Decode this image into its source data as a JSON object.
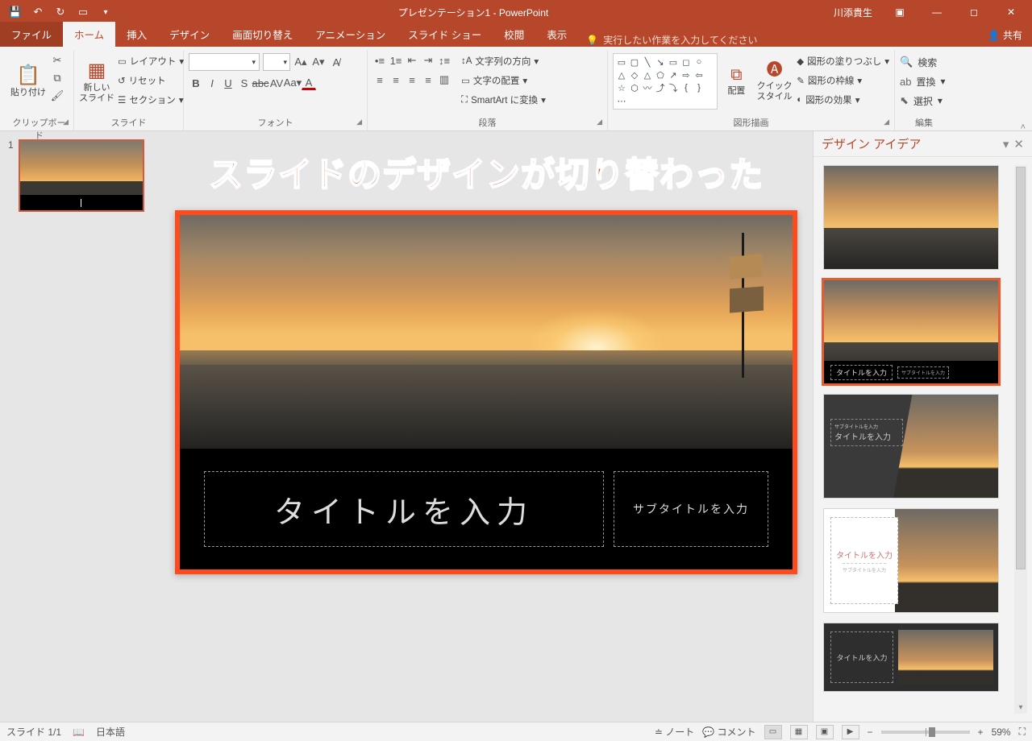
{
  "title": "プレゼンテーション1 - PowerPoint",
  "user": "川添貴生",
  "tabs": {
    "file": "ファイル",
    "home": "ホーム",
    "insert": "挿入",
    "design": "デザイン",
    "transitions": "画面切り替え",
    "animations": "アニメーション",
    "slideshow": "スライド ショー",
    "review": "校閲",
    "view": "表示",
    "tellme": "実行したい作業を入力してください",
    "share": "共有"
  },
  "ribbon": {
    "clipboard": {
      "paste": "貼り付け",
      "label": "クリップボード"
    },
    "slides": {
      "new": "新しい\nスライド",
      "layout": "レイアウト",
      "reset": "リセット",
      "section": "セクション",
      "label": "スライド"
    },
    "font": {
      "label": "フォント",
      "name": "",
      "size": ""
    },
    "para": {
      "textdir": "文字列の方向",
      "align": "文字の配置",
      "smartart": "SmartArt に変換",
      "label": "段落"
    },
    "drawing": {
      "arrange": "配置",
      "quick": "クイック\nスタイル",
      "fill": "図形の塗りつぶし",
      "outline": "図形の枠線",
      "effects": "図形の効果",
      "label": "図形描画"
    },
    "editing": {
      "find": "検索",
      "replace": "置換",
      "select": "選択",
      "label": "編集"
    }
  },
  "overlay": "スライドのデザインが切り替わった",
  "slide": {
    "title_placeholder": "タイトルを入力",
    "subtitle_placeholder": "サブタイトルを入力"
  },
  "pane": {
    "title": "デザイン アイデア",
    "idea2": {
      "title": "タイトルを入力",
      "sub": "サブタイトルを入力"
    },
    "idea3": {
      "sub": "サブタイトルを入力",
      "title": "タイトルを入力"
    },
    "idea4": {
      "title": "タイトルを入力",
      "sub": "サブタイトルを入力"
    },
    "idea5": {
      "title": "タイトルを入力"
    }
  },
  "status": {
    "slide": "スライド 1/1",
    "lang": "日本語",
    "notes": "ノート",
    "comments": "コメント",
    "zoom": "59%"
  },
  "thumb_num": "1"
}
